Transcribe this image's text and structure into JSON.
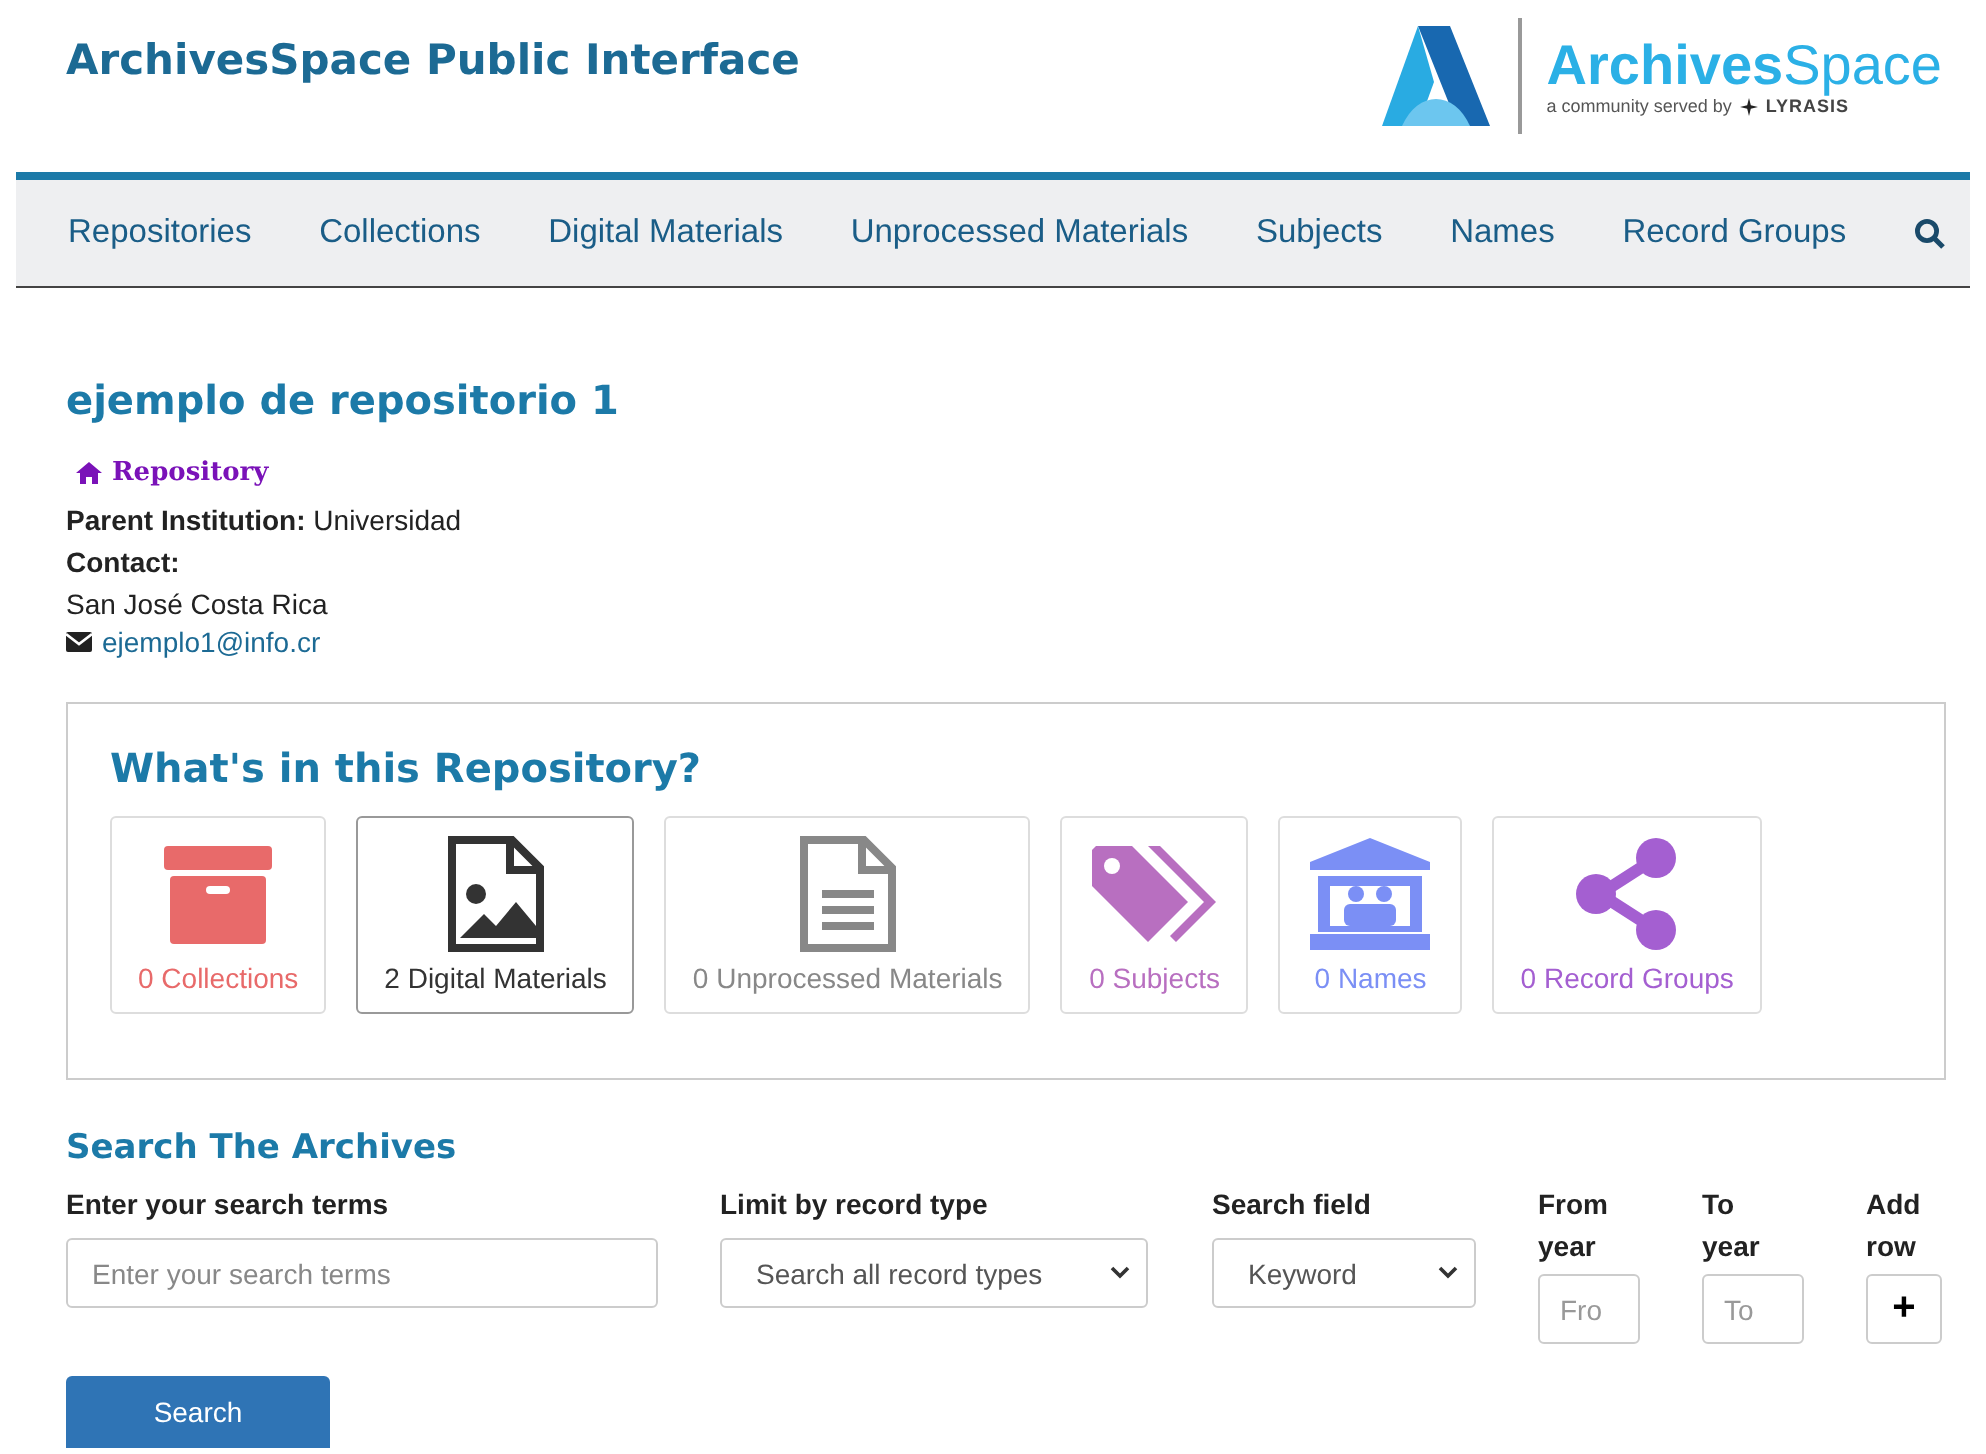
{
  "header": {
    "title": "ArchivesSpace Public Interface",
    "logo": {
      "wordmark": "**Archives**Space",
      "tagline": "a community served by",
      "partner": "LYRASIS"
    }
  },
  "nav": {
    "items": [
      {
        "label": "Repositories"
      },
      {
        "label": "Collections"
      },
      {
        "label": "Digital Materials"
      },
      {
        "label": "Unprocessed Materials"
      },
      {
        "label": "Subjects"
      },
      {
        "label": "Names"
      },
      {
        "label": "Record Groups"
      }
    ]
  },
  "repository": {
    "title": "ejemplo de repositorio 1",
    "type_label": "Repository",
    "parent_label": "Parent Institution:",
    "parent_value": "Universidad",
    "contact_label": "Contact:",
    "address": "San José Costa Rica",
    "email": "ejemplo1@info.cr"
  },
  "contents": {
    "title": "What's in this Repository?",
    "cards": [
      {
        "kind": "box",
        "label": "0 Collections",
        "color": "#e86a6a"
      },
      {
        "kind": "image",
        "label": "2 Digital Materials",
        "color": "#333333"
      },
      {
        "kind": "document",
        "label": "0 Unprocessed Materials",
        "color": "#888888"
      },
      {
        "kind": "tags",
        "label": "0 Subjects",
        "color": "#b86fc0"
      },
      {
        "kind": "building",
        "label": "0 Names",
        "color": "#7b8ff5"
      },
      {
        "kind": "share",
        "label": "0 Record Groups",
        "color": "#a45fd1"
      }
    ]
  },
  "search": {
    "title": "Search The Archives",
    "terms_label": "Enter your search terms",
    "terms_placeholder": "Enter your search terms",
    "type_label": "Limit by record type",
    "type_value": "Search all record types",
    "field_label": "Search field",
    "field_value": "Keyword",
    "from_label": "From year",
    "from_placeholder": "Fro",
    "to_label": "To year",
    "to_placeholder": "To",
    "add_label": "Add row",
    "add_button": "+",
    "submit": "Search"
  }
}
